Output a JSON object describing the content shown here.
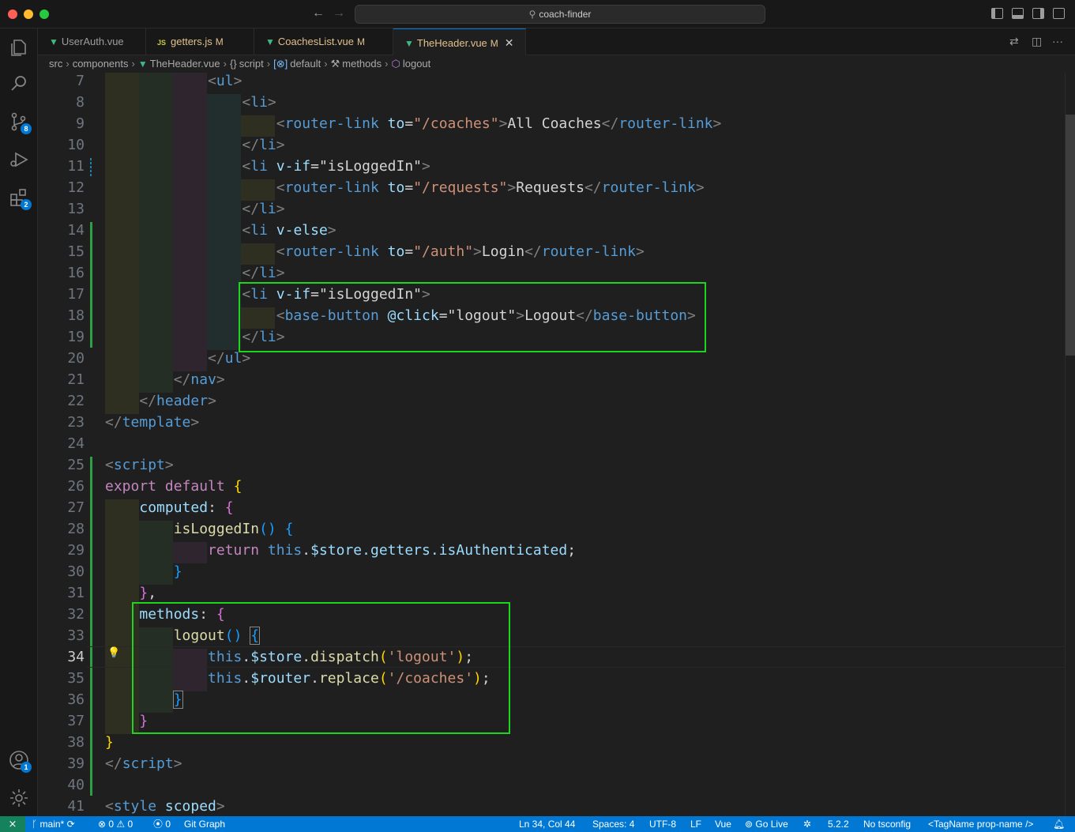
{
  "titlebar": {
    "search_text": "coach-finder"
  },
  "activity_badges": {
    "source_control": "8",
    "extensions": "2",
    "accounts": "1"
  },
  "tabs": [
    {
      "label": "UserAuth.vue",
      "modified": "",
      "type": "vue"
    },
    {
      "label": "getters.js",
      "modified": "M",
      "type": "js"
    },
    {
      "label": "CoachesList.vue",
      "modified": "M",
      "type": "vue"
    },
    {
      "label": "TheHeader.vue",
      "modified": "M",
      "type": "vue",
      "active": true
    }
  ],
  "breadcrumb": [
    "src",
    "components",
    "TheHeader.vue",
    "script",
    "default",
    "methods",
    "logout"
  ],
  "code_lines": [
    {
      "n": "7"
    },
    {
      "n": "8"
    },
    {
      "n": "9"
    },
    {
      "n": "10"
    },
    {
      "n": "11"
    },
    {
      "n": "12"
    },
    {
      "n": "13"
    },
    {
      "n": "14"
    },
    {
      "n": "15"
    },
    {
      "n": "16"
    },
    {
      "n": "17"
    },
    {
      "n": "18"
    },
    {
      "n": "19"
    },
    {
      "n": "20"
    },
    {
      "n": "21"
    },
    {
      "n": "22"
    },
    {
      "n": "23"
    },
    {
      "n": "24"
    },
    {
      "n": "25"
    },
    {
      "n": "26"
    },
    {
      "n": "27"
    },
    {
      "n": "28"
    },
    {
      "n": "29"
    },
    {
      "n": "30"
    },
    {
      "n": "31"
    },
    {
      "n": "32"
    },
    {
      "n": "33"
    },
    {
      "n": "34"
    },
    {
      "n": "35"
    },
    {
      "n": "36"
    },
    {
      "n": "37"
    },
    {
      "n": "38"
    },
    {
      "n": "39"
    },
    {
      "n": "40"
    },
    {
      "n": "41"
    }
  ],
  "code_text": {
    "l7": "<ul>",
    "l9_to": "\"/coaches\"",
    "l9_text": "All Coaches",
    "l11_if": "\"isLoggedIn\"",
    "l12_to": "\"/requests\"",
    "l12_text": "Requests",
    "l15_to": "\"/auth\"",
    "l15_text": "Login",
    "l17_if": "\"isLoggedIn\"",
    "l18_click": "\"logout\"",
    "l18_text": "Logout",
    "l28_fn": "isLoggedIn",
    "l29_chain": "$store.getters.isAuthenticated",
    "l33_fn": "logout",
    "l34_arg": "'logout'",
    "l35_arg": "'/coaches'"
  },
  "status": {
    "branch": "main*",
    "errors": "0",
    "warnings": "0",
    "ports": "0",
    "git_graph": "Git Graph",
    "position": "Ln 34, Col 44",
    "spaces": "Spaces: 4",
    "encoding": "UTF-8",
    "eol": "LF",
    "language": "Vue",
    "go_live": "Go Live",
    "version": "5.2.2",
    "tsconfig": "No tsconfig",
    "tagname": "<TagName prop-name />"
  },
  "colors": {
    "accent": "#0078d4",
    "highlight_box": "#1fd41f",
    "git_added": "#2ea043"
  }
}
